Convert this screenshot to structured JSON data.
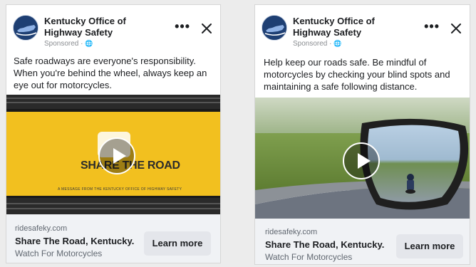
{
  "ads": [
    {
      "page_name": "Kentucky Office of Highway Safety",
      "sponsored": "Sponsored ·",
      "globe_icon": "🌐",
      "more_icon": "•••",
      "close_icon": "close-icon",
      "body_text": "Safe roadways are everyone's responsibility. When you're behind the wheel, always keep an eye out for motorcycles.",
      "media": {
        "share_the_road": "SHARE THE ROAD",
        "message": "A MESSAGE FROM THE KENTUCKY OFFICE OF HIGHWAY SAFETY"
      },
      "domain": "ridesafeky.com",
      "headline": "Share The Road, Kentucky.",
      "subheadline": "Watch For Motorcycles",
      "cta": "Learn more"
    },
    {
      "page_name": "Kentucky Office of Highway Safety",
      "sponsored": "Sponsored ·",
      "globe_icon": "🌐",
      "more_icon": "•••",
      "close_icon": "close-icon",
      "body_text": "Help keep our roads safe. Be mindful of motorcycles by checking your blind spots and maintaining a safe following distance.",
      "domain": "ridesafeky.com",
      "headline": "Share The Road, Kentucky.",
      "subheadline": "Watch For Motorcycles",
      "cta": "Learn more"
    }
  ],
  "colors": {
    "brand_navy": "#1e3f73",
    "road_yellow": "#f2c01f",
    "button_gray": "#e4e6eb",
    "footer_gray": "#f0f2f5"
  }
}
